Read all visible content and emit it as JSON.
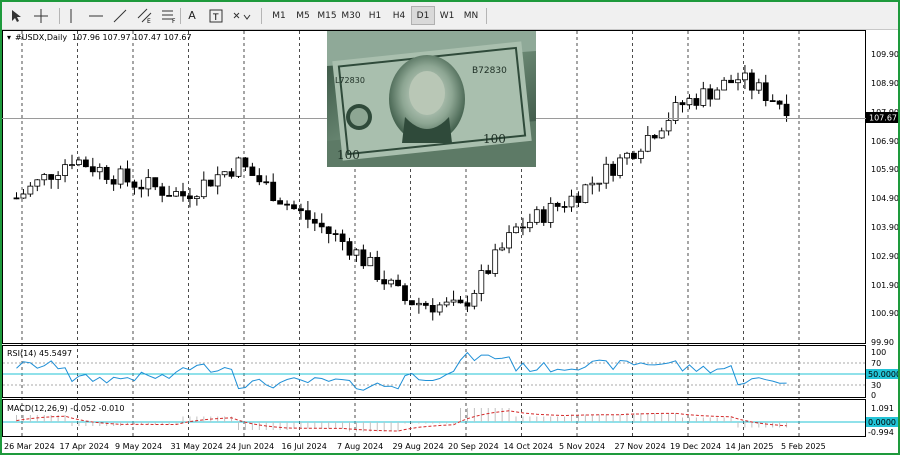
{
  "toolbar": {
    "timeframes": [
      "M1",
      "M5",
      "M15",
      "M30",
      "H1",
      "H4",
      "D1",
      "W1",
      "MN"
    ],
    "active_timeframe": "D1"
  },
  "header": {
    "symbol_label": "#USDX,Daily",
    "ohlc": "107.96 107.97 107.47 107.67"
  },
  "price_axis": {
    "ticks": [
      "109.90",
      "108.90",
      "107.90",
      "106.90",
      "105.90",
      "104.90",
      "103.90",
      "102.90",
      "101.90",
      "100.90",
      "99.90"
    ],
    "current_price": "107.67"
  },
  "rsi": {
    "label": "RSI(14) 45.5497",
    "levels": [
      "100",
      "70",
      "50.0000",
      "30",
      "0"
    ]
  },
  "macd": {
    "label": "MACD(12,26,9) -0.052 -0.010",
    "levels": [
      "1.091",
      "0.0000",
      "-0.994"
    ]
  },
  "date_axis": [
    "26 Mar 2024",
    "17 Apr 2024",
    "9 May 2024",
    "31 May 2024",
    "24 Jun 2024",
    "16 Jul 2024",
    "7 Aug 2024",
    "29 Aug 2024",
    "20 Sep 2024",
    "14 Oct 2024",
    "5 Nov 2024",
    "27 Nov 2024",
    "19 Dec 2024",
    "14 Jan 2025",
    "5 Feb 2025"
  ],
  "chart_data": {
    "type": "candlestick",
    "symbol": "#USDX",
    "timeframe": "Daily",
    "ylim": [
      99.5,
      110.5
    ],
    "x": [
      "26 Mar 2024",
      "17 Apr 2024",
      "9 May 2024",
      "31 May 2024",
      "24 Jun 2024",
      "16 Jul 2024",
      "7 Aug 2024",
      "29 Aug 2024",
      "20 Sep 2024",
      "14 Oct 2024",
      "5 Nov 2024",
      "27 Nov 2024",
      "19 Dec 2024",
      "14 Jan 2025",
      "5 Feb 2025"
    ],
    "close_approx": [
      104.6,
      106.0,
      105.2,
      104.7,
      105.8,
      104.2,
      102.9,
      101.0,
      100.7,
      103.5,
      104.6,
      106.1,
      107.9,
      108.8,
      107.7
    ],
    "last": {
      "open": 107.96,
      "high": 107.97,
      "low": 107.47,
      "close": 107.67
    }
  },
  "colors": {
    "frame": "#1e9a3c",
    "rsi_line": "#1e8fd6",
    "level_line": "#22c3d6",
    "macd_signal": "#d42a2a"
  }
}
